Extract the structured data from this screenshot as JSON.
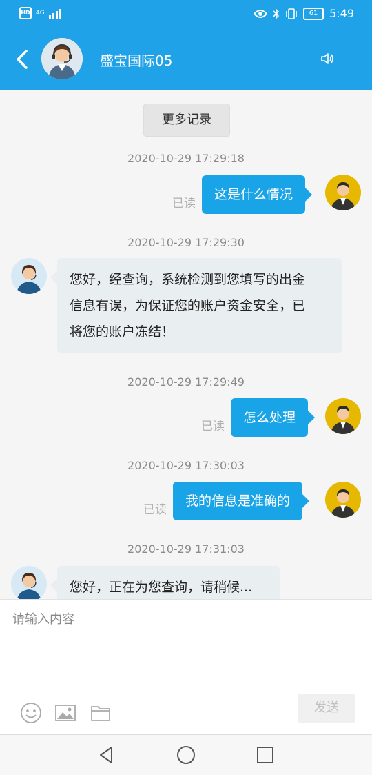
{
  "status_bar": {
    "hd": "HD",
    "network": "4G",
    "battery": "61",
    "time": "5:49",
    "icons": [
      "eye-icon",
      "bluetooth-icon",
      "vibrate-icon",
      "battery-icon"
    ]
  },
  "header": {
    "title": "盛宝国际05",
    "icons": [
      "back-arrow-icon",
      "agent-avatar",
      "speaker-icon"
    ]
  },
  "chat": {
    "more_label": "更多记录",
    "messages": [
      {
        "time": "2020-10-29 17:29:18",
        "side": "right",
        "text": "这是什么情况",
        "status": "已读"
      },
      {
        "time": "2020-10-29 17:29:30",
        "side": "left",
        "lines": [
          "您好，经查询，系统检测到您填写的出金",
          "信息有误，为保证您的账户资金安全，已",
          "将您的账户冻结！"
        ]
      },
      {
        "time": "2020-10-29 17:29:49",
        "side": "right",
        "text": "怎么处理",
        "status": "已读"
      },
      {
        "time": "2020-10-29 17:30:03",
        "side": "right",
        "text": "我的信息是准确的",
        "status": "已读"
      },
      {
        "time": "2020-10-29 17:31:03",
        "side": "left",
        "lines": [
          "您好，正在为您查询，请稍候..."
        ]
      }
    ]
  },
  "input": {
    "placeholder": "请输入内容",
    "send_label": "发送",
    "tools": [
      "emoji-icon",
      "image-icon",
      "folder-icon"
    ]
  },
  "navbar": {
    "icons": [
      "back-triangle-icon",
      "home-circle-icon",
      "recents-square-icon"
    ]
  },
  "colors": {
    "accent": "#20a2e8",
    "bubble_right": "#1aa4e8",
    "bubble_left": "#e9eef0"
  }
}
